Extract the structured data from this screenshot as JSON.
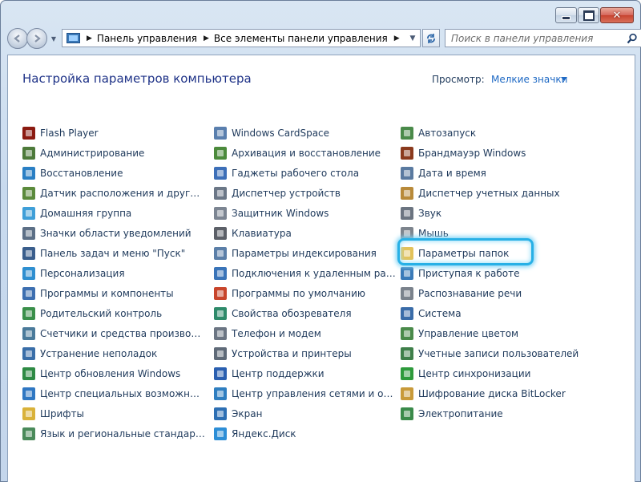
{
  "window": {
    "close_glyph": "✕"
  },
  "address": {
    "crumbs": [
      "Панель управления",
      "Все элементы панели управления"
    ]
  },
  "search": {
    "placeholder": "Поиск в панели управления"
  },
  "header": {
    "title": "Настройка параметров компьютера",
    "view_label": "Просмотр:",
    "view_value": "Мелкие значки"
  },
  "columns": [
    [
      {
        "label": "Flash Player",
        "icon": "flash-player-icon",
        "color": "#8b1a10"
      },
      {
        "label": "Администрирование",
        "icon": "administrative-tools-icon",
        "color": "#4d7a3a"
      },
      {
        "label": "Восстановление",
        "icon": "recovery-icon",
        "color": "#2a7fc4"
      },
      {
        "label": "Датчик расположения и другие дат...",
        "icon": "location-sensor-icon",
        "color": "#5b8a3c"
      },
      {
        "label": "Домашняя группа",
        "icon": "homegroup-icon",
        "color": "#3f9fd8"
      },
      {
        "label": "Значки области уведомлений",
        "icon": "notification-icons-icon",
        "color": "#5c6f86"
      },
      {
        "label": "Панель задач и меню \"Пуск\"",
        "icon": "taskbar-start-icon",
        "color": "#3a5e8c"
      },
      {
        "label": "Персонализация",
        "icon": "personalization-icon",
        "color": "#2f8fd0"
      },
      {
        "label": "Программы и компоненты",
        "icon": "programs-features-icon",
        "color": "#3d6fb0"
      },
      {
        "label": "Родительский контроль",
        "icon": "parental-controls-icon",
        "color": "#3a8f4a"
      },
      {
        "label": "Счетчики и средства производител...",
        "icon": "performance-icon",
        "color": "#4a7a9a"
      },
      {
        "label": "Устранение неполадок",
        "icon": "troubleshooting-icon",
        "color": "#3a6ea8"
      },
      {
        "label": "Центр обновления Windows",
        "icon": "windows-update-icon",
        "color": "#2e8a44"
      },
      {
        "label": "Центр специальных возможностей",
        "icon": "ease-of-access-icon",
        "color": "#2f77c2"
      },
      {
        "label": "Шрифты",
        "icon": "fonts-icon",
        "color": "#d9b23a"
      },
      {
        "label": "Язык и региональные стандарты",
        "icon": "region-language-icon",
        "color": "#4a8a5a"
      }
    ],
    [
      {
        "label": "Windows CardSpace",
        "icon": "cardspace-icon",
        "color": "#5a7fae"
      },
      {
        "label": "Архивация и восстановление",
        "icon": "backup-restore-icon",
        "color": "#4b8a3c"
      },
      {
        "label": "Гаджеты рабочего стола",
        "icon": "desktop-gadgets-icon",
        "color": "#3d6fb8"
      },
      {
        "label": "Диспетчер устройств",
        "icon": "device-manager-icon",
        "color": "#6b7787"
      },
      {
        "label": "Защитник Windows",
        "icon": "windows-defender-icon",
        "color": "#7c8592"
      },
      {
        "label": "Клавиатура",
        "icon": "keyboard-icon",
        "color": "#5c6068"
      },
      {
        "label": "Параметры индексирования",
        "icon": "indexing-options-icon",
        "color": "#5b7fa8"
      },
      {
        "label": "Подключения к удаленным рабоч...",
        "icon": "remoteapp-icon",
        "color": "#3a74b8"
      },
      {
        "label": "Программы по умолчанию",
        "icon": "default-programs-icon",
        "color": "#c8452c"
      },
      {
        "label": "Свойства обозревателя",
        "icon": "internet-options-icon",
        "color": "#2e8a6a"
      },
      {
        "label": "Телефон и модем",
        "icon": "phone-modem-icon",
        "color": "#6b7583"
      },
      {
        "label": "Устройства и принтеры",
        "icon": "devices-printers-icon",
        "color": "#5f6a78"
      },
      {
        "label": "Центр поддержки",
        "icon": "action-center-icon",
        "color": "#2a5fb0"
      },
      {
        "label": "Центр управления сетями и общи...",
        "icon": "network-sharing-icon",
        "color": "#2f7ec0"
      },
      {
        "label": "Экран",
        "icon": "display-icon",
        "color": "#2d6fb3"
      },
      {
        "label": "Яндекс.Диск",
        "icon": "yandex-disk-icon",
        "color": "#2d8ed6"
      }
    ],
    [
      {
        "label": "Автозапуск",
        "icon": "autoplay-icon",
        "color": "#4a8a4a"
      },
      {
        "label": "Брандмауэр Windows",
        "icon": "windows-firewall-icon",
        "color": "#8a3a1e"
      },
      {
        "label": "Дата и время",
        "icon": "date-time-icon",
        "color": "#5a7aa0"
      },
      {
        "label": "Диспетчер учетных данных",
        "icon": "credential-manager-icon",
        "color": "#b88a3a"
      },
      {
        "label": "Звук",
        "icon": "sound-icon",
        "color": "#6b7480"
      },
      {
        "label": "Мышь",
        "icon": "mouse-icon",
        "color": "#7d848d"
      },
      {
        "label": "Параметры папок",
        "icon": "folder-options-icon",
        "color": "#e2c25a"
      },
      {
        "label": "Приступая к работе",
        "icon": "getting-started-icon",
        "color": "#3a7ab8"
      },
      {
        "label": "Распознавание речи",
        "icon": "speech-recognition-icon",
        "color": "#7a828c"
      },
      {
        "label": "Система",
        "icon": "system-icon",
        "color": "#3a6ca8"
      },
      {
        "label": "Управление цветом",
        "icon": "color-management-icon",
        "color": "#4a8a4a"
      },
      {
        "label": "Учетные записи пользователей",
        "icon": "user-accounts-icon",
        "color": "#3f7f4a"
      },
      {
        "label": "Центр синхронизации",
        "icon": "sync-center-icon",
        "color": "#2e9a3c"
      },
      {
        "label": "Шифрование диска BitLocker",
        "icon": "bitlocker-icon",
        "color": "#c89a3a"
      },
      {
        "label": "Электропитание",
        "icon": "power-options-icon",
        "color": "#3a8a4a"
      }
    ]
  ]
}
